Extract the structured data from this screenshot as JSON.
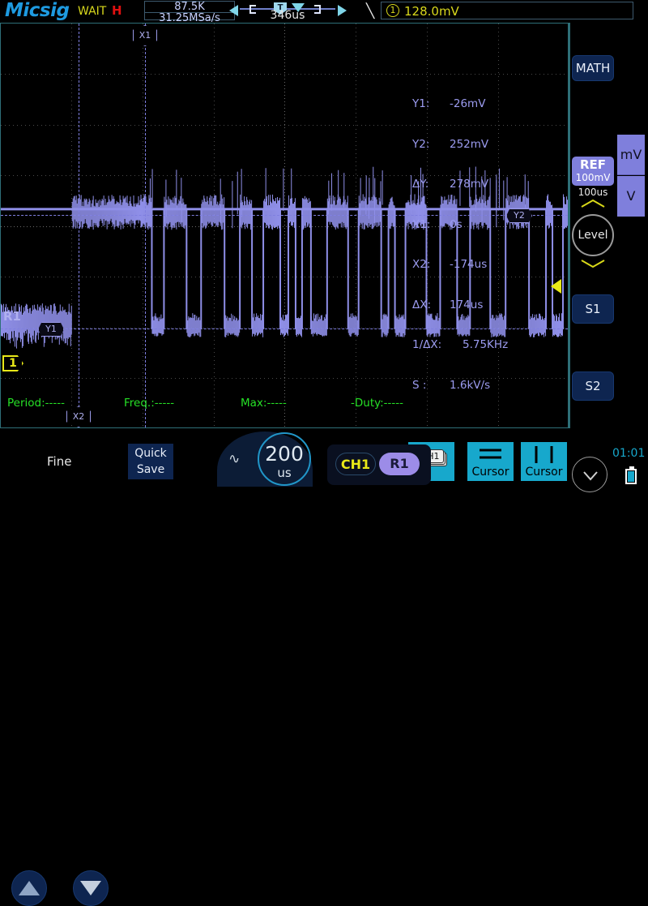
{
  "header": {
    "brand": "Micsig",
    "status": "WAIT",
    "trigger_mode": "H",
    "memory_depth": "87.5K",
    "sample_rate": "31.25MSa/s",
    "horizontal_position": "346us",
    "trigger_marker": "T",
    "trigger_slope_icon": "falling-edge-icon",
    "trigger_channel": "1",
    "trigger_level": "128.0mV"
  },
  "cursors": {
    "readout": [
      {
        "label": "Y1:",
        "value": "-26mV"
      },
      {
        "label": "Y2:",
        "value": "252mV"
      },
      {
        "label": "ΔY:",
        "value": "278mV"
      },
      {
        "label": "X1:",
        "value": "0s"
      },
      {
        "label": "X2:",
        "value": "-174us"
      },
      {
        "label": "ΔX:",
        "value": "174us"
      },
      {
        "label": "1/ΔX:",
        "value": "5.75KHz"
      },
      {
        "label": "S :",
        "value": "1.6kV/s"
      }
    ],
    "x1_marker": "X1",
    "x2_marker": "X2",
    "y1_marker": "Y1",
    "y2_marker": "Y2"
  },
  "plot": {
    "reference_label": "R1",
    "ground_marker": "1",
    "waveform_color": "#8f8fe8"
  },
  "measurements": [
    {
      "label": "Period:",
      "value": "-----"
    },
    {
      "label": "Freq.:",
      "value": "-----"
    },
    {
      "label": "Max:",
      "value": "-----"
    },
    {
      "label": "-Duty:",
      "value": "-----"
    }
  ],
  "sidebar": {
    "math_label": "MATH",
    "ref_label": "REF",
    "ref_scale": "100mV",
    "ref_timebase": "100us",
    "unit_mv": "mV",
    "unit_v": "V",
    "level_label": "Level",
    "s1_label": "S1",
    "s2_label": "S2"
  },
  "bottom": {
    "fine_label": "Fine",
    "up_arrow_icon": "triangle-up-icon",
    "down_arrow_icon": "triangle-down-icon",
    "quick_save_line1": "Quick",
    "quick_save_line2": "Save",
    "timebase_value": "200",
    "timebase_unit": "us",
    "wave_icon": "sine-wave-icon",
    "channel_ch1": "CH1",
    "channel_r1": "R1",
    "ch1_stack_icon": "ch1-stack-icon",
    "cursor_h_label": "Cursor",
    "cursor_v_label": "Cursor",
    "chevron_icon": "chevron-down-icon",
    "clock": "01:01",
    "battery_icon": "battery-icon"
  },
  "colors": {
    "brand": "#1e9ae0",
    "waveform": "#8f8fe8",
    "cursor": "#7f7fe0",
    "measurement": "#26e026",
    "trigger": "#d8d81c",
    "teal": "#17a8cc"
  }
}
